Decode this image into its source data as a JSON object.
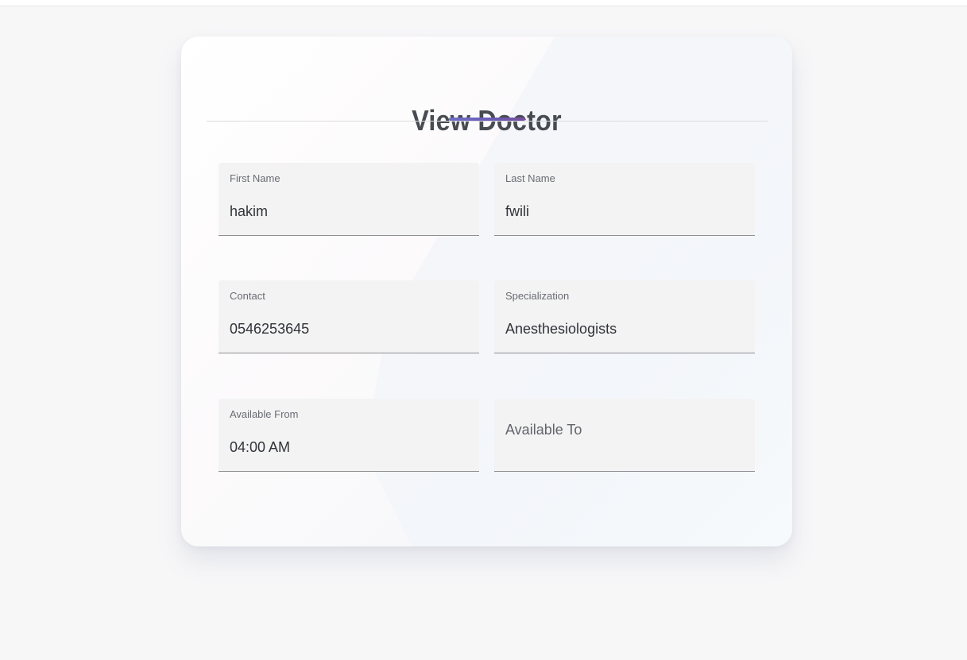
{
  "page": {
    "title": "View Doctor"
  },
  "theme": {
    "accent": "#6a5bb2",
    "background": "#f7f7f8",
    "field_fill": "#f3f3f4",
    "text_primary": "#303338"
  },
  "form": {
    "first_name": {
      "label": "First Name",
      "value": "hakim"
    },
    "last_name": {
      "label": "Last Name",
      "value": "fwili"
    },
    "contact": {
      "label": "Contact",
      "value": "0546253645"
    },
    "specialization": {
      "label": "Specialization",
      "value": "Anesthesiologists"
    },
    "available_from": {
      "label": "Available From",
      "value": "04:00 AM"
    },
    "available_to": {
      "label": "Available To",
      "value": ""
    }
  }
}
